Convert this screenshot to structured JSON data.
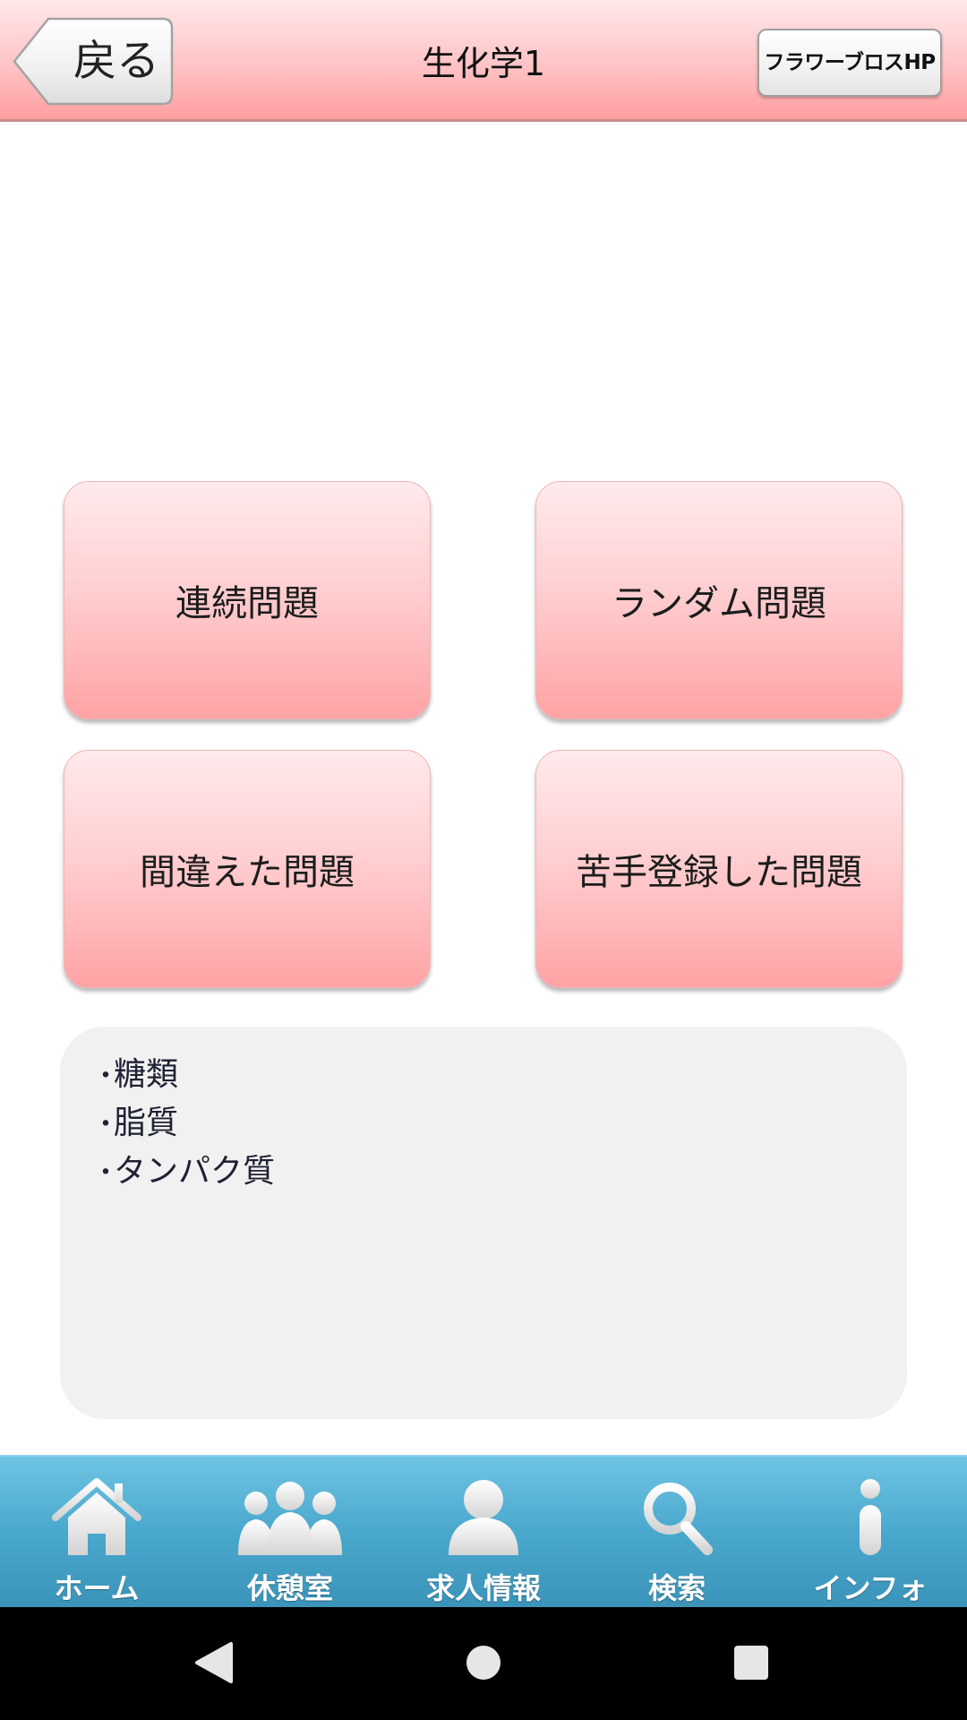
{
  "header": {
    "back_label": "戻る",
    "title": "生化学1",
    "hp_button_label": "フラワーブロスHP"
  },
  "quiz_buttons": {
    "sequential": "連続問題",
    "random": "ランダム問題",
    "mistakes": "間違えた問題",
    "weak": "苦手登録した問題"
  },
  "topics": {
    "bullet": "・",
    "items": [
      "糖類",
      "脂質",
      "タンパク質"
    ]
  },
  "tab_bar": {
    "items": [
      {
        "label": "ホーム",
        "icon": "home-icon"
      },
      {
        "label": "休憩室",
        "icon": "people-icon"
      },
      {
        "label": "求人情報",
        "icon": "person-icon"
      },
      {
        "label": "検索",
        "icon": "search-icon"
      },
      {
        "label": "インフォ",
        "icon": "info-icon"
      }
    ]
  },
  "colors": {
    "header_gradient_top": "#ffe9ea",
    "header_gradient_bottom": "#ff9ea1",
    "button_gradient_top": "#ffeaec",
    "button_gradient_bottom": "#ffa3a5",
    "panel_bg": "#f1f1f1",
    "tab_bar_top": "#6fc4e3",
    "tab_bar_bottom": "#3b93b9"
  }
}
